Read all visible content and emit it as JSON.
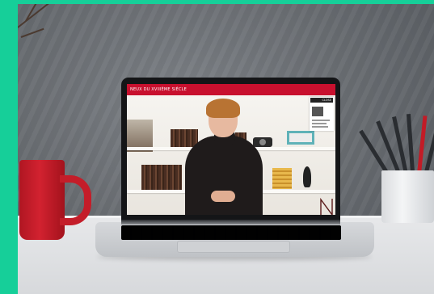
{
  "screen": {
    "header_text": "NEUX DU XVIIIÈME SIÈCLE",
    "thumbnail_badge": "CLOSE"
  },
  "colors": {
    "frame_border": "#16cf99",
    "header_red": "#c8102e",
    "mug_red": "#c41d29",
    "wall_gray": "#6a6e73"
  },
  "icons": {
    "logo": "N-monogram-logo"
  }
}
